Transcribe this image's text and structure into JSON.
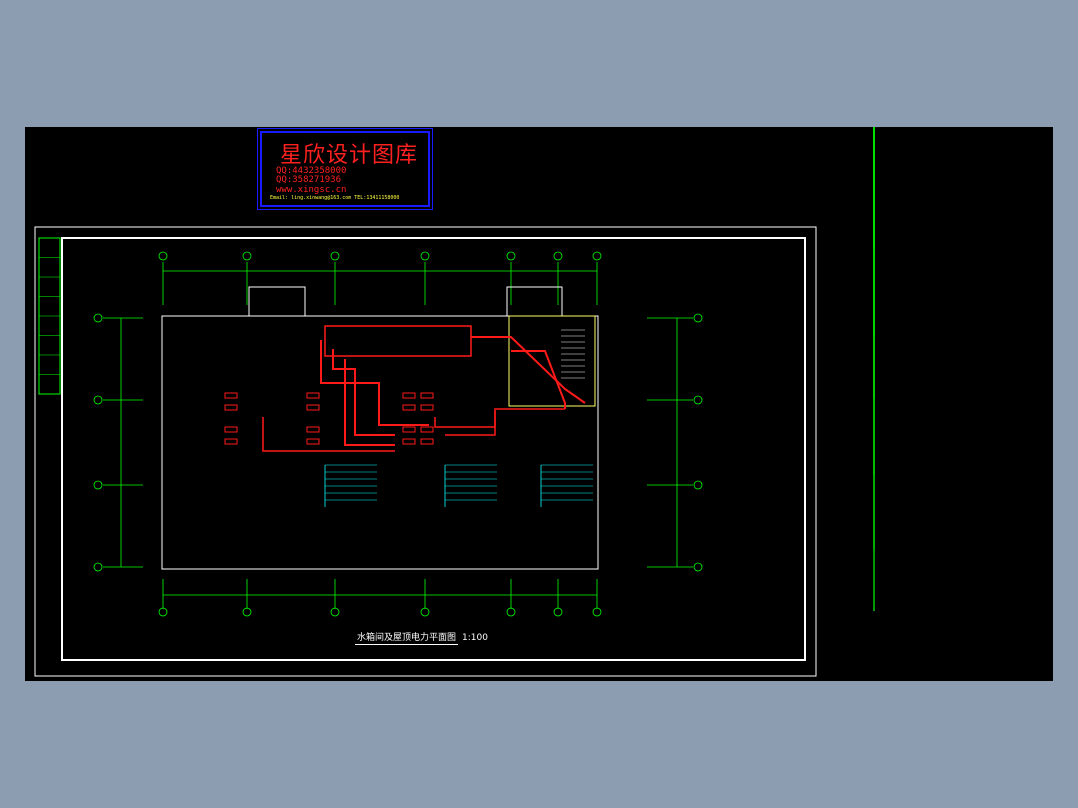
{
  "watermark": {
    "title": "星欣设计图库",
    "line_qq1": "QQ:4432358000",
    "line_qq2": "QQ:358271936",
    "line_url": "www.xingsc.cn",
    "line_small": "Email: ling.xinwang@163.com  TEL:13411158000"
  },
  "drawing": {
    "title": "水箱间及屋顶电力平面图",
    "scale": "1:100"
  },
  "colors": {
    "background": "#000000",
    "frame": "#ffffff",
    "grid": "#00ff00",
    "circuit": "#ff1a1a",
    "annotation": "#00ffff",
    "stair": "#ffff66",
    "window_bg": "#8c9db2"
  }
}
